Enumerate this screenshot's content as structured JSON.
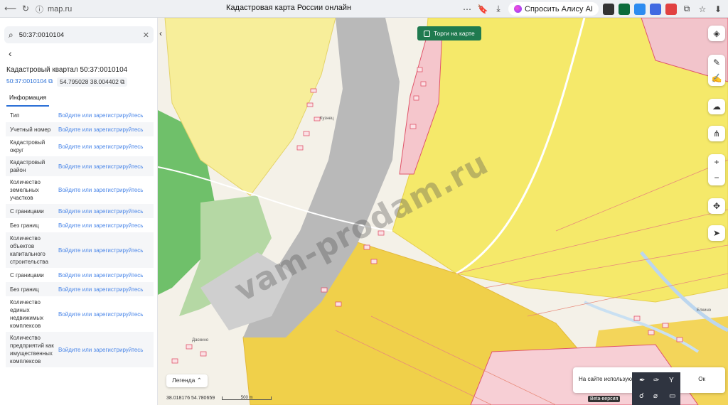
{
  "browser": {
    "url": "map.ru",
    "title": "Кадастровая карта России онлайн",
    "alisa": "Спросить Алису AI"
  },
  "search": {
    "value": "50:37:0010104"
  },
  "quarter": {
    "title": "Кадастровый квартал 50:37:0010104",
    "cad_number": "50:37:0010104",
    "coords": "54.795028 38.004402"
  },
  "tabs": [
    {
      "label": "Информация"
    }
  ],
  "info_rows": [
    {
      "key": "Тип",
      "value": "Войдите или зарегистрируйтесь"
    },
    {
      "key": "Учетный номер",
      "value": "Войдите или зарегистрируйтесь"
    },
    {
      "key": "Кадастровый округ",
      "value": "Войдите или зарегистрируйтесь"
    },
    {
      "key": "Кадастровый район",
      "value": "Войдите или зарегистрируйтесь"
    },
    {
      "key": "Количество земельных участков",
      "value": "Войдите или зарегистрируйтесь"
    },
    {
      "key": "С границами",
      "value": "Войдите или зарегистрируйтесь"
    },
    {
      "key": "Без границ",
      "value": "Войдите или зарегистрируйтесь"
    },
    {
      "key": "Количество объектов капитального строительства",
      "value": "Войдите или зарегистрируйтесь"
    },
    {
      "key": "С границами",
      "value": "Войдите или зарегистрируйтесь"
    },
    {
      "key": "Без границ",
      "value": "Войдите или зарегистрируйтесь"
    },
    {
      "key": "Количество единых недвижимых комплексов",
      "value": "Войдите или зарегистрируйтесь"
    },
    {
      "key": "Количество предприятий как имущественных комплексов",
      "value": "Войдите или зарегистрируйтесь"
    }
  ],
  "map": {
    "torgi_label": "Торги на карте",
    "legend_label": "Легенда",
    "coords": "38.018176  54.780659",
    "scale_label": "500 m",
    "beta_label": "Beta-версия",
    "cookie_text": "На сайте используются",
    "cookie_ok": "Ок",
    "watermark": "vam-prodam.ru",
    "place_labels": [
      "Кузнец",
      "Даскино",
      "Елкино"
    ]
  },
  "colors": {
    "accent": "#2a6fd6",
    "torgi_bg": "#1f7a4f",
    "field": "#f5e96a",
    "plot_border": "#e0556a"
  }
}
